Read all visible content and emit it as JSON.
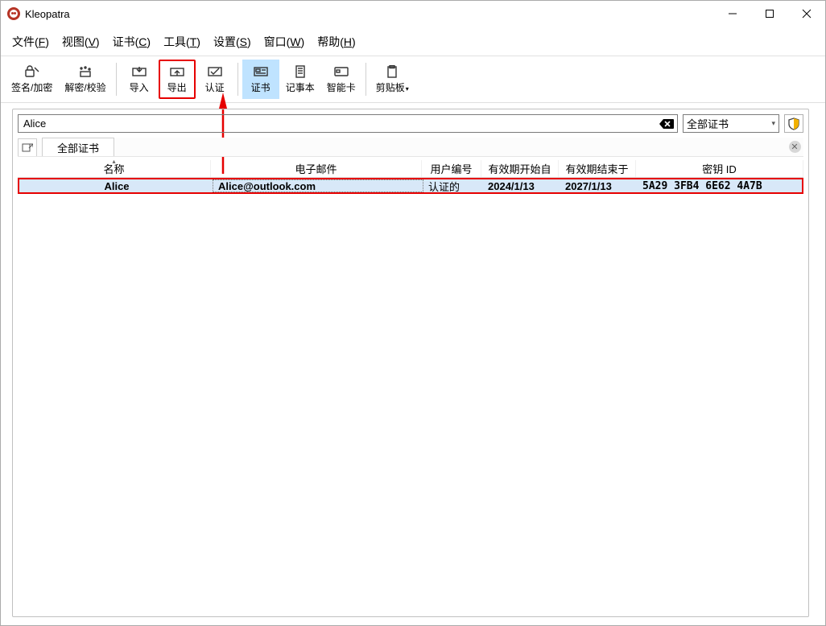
{
  "window": {
    "title": "Kleopatra"
  },
  "menu": {
    "file": {
      "text": "文件(",
      "hot": "F",
      "tail": ")"
    },
    "view": {
      "text": "视图(",
      "hot": "V",
      "tail": ")"
    },
    "certs": {
      "text": "证书(",
      "hot": "C",
      "tail": ")"
    },
    "tools": {
      "text": "工具(",
      "hot": "T",
      "tail": ")"
    },
    "settings": {
      "text": "设置(",
      "hot": "S",
      "tail": ")"
    },
    "window": {
      "text": "窗口(",
      "hot": "W",
      "tail": ")"
    },
    "help": {
      "text": "帮助(",
      "hot": "H",
      "tail": ")"
    }
  },
  "toolbar": {
    "sign_encrypt": "签名/加密",
    "decrypt_verify": "解密/校验",
    "import": "导入",
    "export": "导出",
    "certify": "认证",
    "certificates": "证书",
    "notepad": "记事本",
    "smartcard": "智能卡",
    "clipboard": "剪贴板"
  },
  "search": {
    "value": "Alice",
    "filter_label": "全部证书"
  },
  "tabs": {
    "active_label": "全部证书"
  },
  "columns": {
    "name": "名称",
    "email": "电子邮件",
    "userid": "用户编号",
    "valid_from": "有效期开始自",
    "valid_to": "有效期结束于",
    "keyid": "密钥 ID"
  },
  "rows": [
    {
      "name": "Alice",
      "email": "Alice@outlook.com",
      "userid": "认证的",
      "valid_from": "2024/1/13",
      "valid_to": "2027/1/13",
      "keyid": "5A29 3FB4 6E62 4A7B"
    }
  ]
}
